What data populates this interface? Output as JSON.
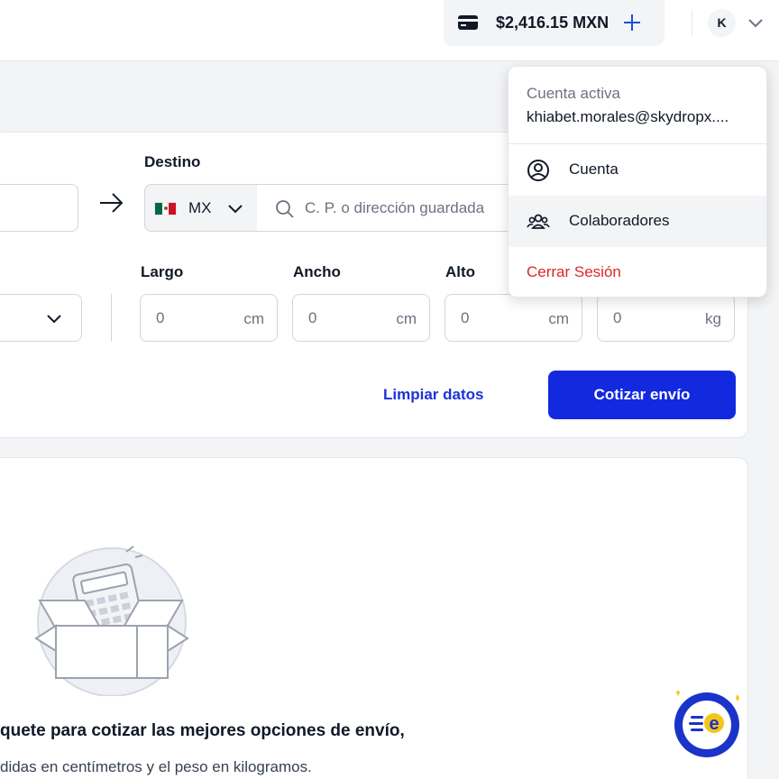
{
  "header": {
    "balance": "$2,416.15 MXN",
    "avatar_initial": "K"
  },
  "quote_form": {
    "destination_label": "Destino",
    "country_code": "MX",
    "address_placeholder": "C. P. o dirección guardada",
    "dimensions": [
      {
        "label": "Largo",
        "value": "0",
        "unit": "cm"
      },
      {
        "label": "Ancho",
        "value": "0",
        "unit": "cm"
      },
      {
        "label": "Alto",
        "value": "0",
        "unit": "cm"
      },
      {
        "label": "",
        "value": "0",
        "unit": "kg"
      }
    ],
    "clear_label": "Limpiar datos",
    "submit_label": "Cotizar envío"
  },
  "empty_state": {
    "title": "quete para cotizar las mejores opciones de envío,",
    "subtitle": "didas en centímetros y el peso en kilogramos."
  },
  "user_menu": {
    "active_account_label": "Cuenta activa",
    "email": "khiabet.morales@skydropx....",
    "items": [
      {
        "label": "Cuenta",
        "icon": "user-circle-icon"
      },
      {
        "label": "Colaboradores",
        "icon": "users-group-icon"
      },
      {
        "label": "Cerrar Sesión",
        "icon": ""
      }
    ]
  },
  "colors": {
    "primary": "#1329e0",
    "link": "#1d32d8",
    "danger": "#dc2626",
    "background": "#f3f4f6"
  }
}
